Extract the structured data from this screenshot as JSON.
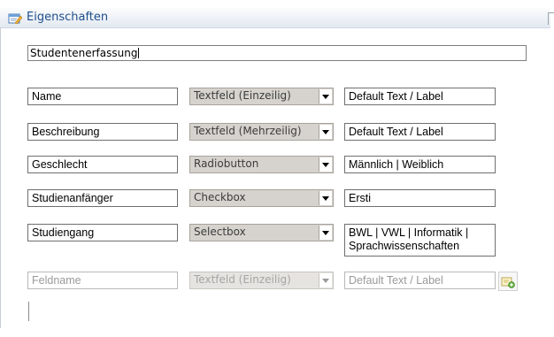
{
  "header": {
    "title": "Eigenschaften",
    "icon": "properties-edit-icon"
  },
  "form": {
    "title_value": "Studentenerfassung"
  },
  "rows": [
    {
      "name": "Name",
      "type": "Textfeld (Einzeilig)",
      "label": "Default Text / Label"
    },
    {
      "name": "Beschreibung",
      "type": "Textfeld (Mehrzeilig)",
      "label": "Default Text / Label"
    },
    {
      "name": "Geschlecht",
      "type": "Radiobutton",
      "label": "Männlich | Weiblich"
    },
    {
      "name": "Studienanfänger",
      "type": "Checkbox",
      "label": "Ersti"
    },
    {
      "name": "Studiengang",
      "type": "Selectbox",
      "label": "BWL | VWL | Informatik | Sprachwissenschaften"
    }
  ],
  "new_row": {
    "name_placeholder": "Feldname",
    "type": "Textfeld (Einzeilig)",
    "label_placeholder": "Default Text / Label",
    "add_icon": "add-field-icon"
  },
  "colors": {
    "header_text": "#1f4e8c",
    "select_bg": "#d6d3ce"
  }
}
